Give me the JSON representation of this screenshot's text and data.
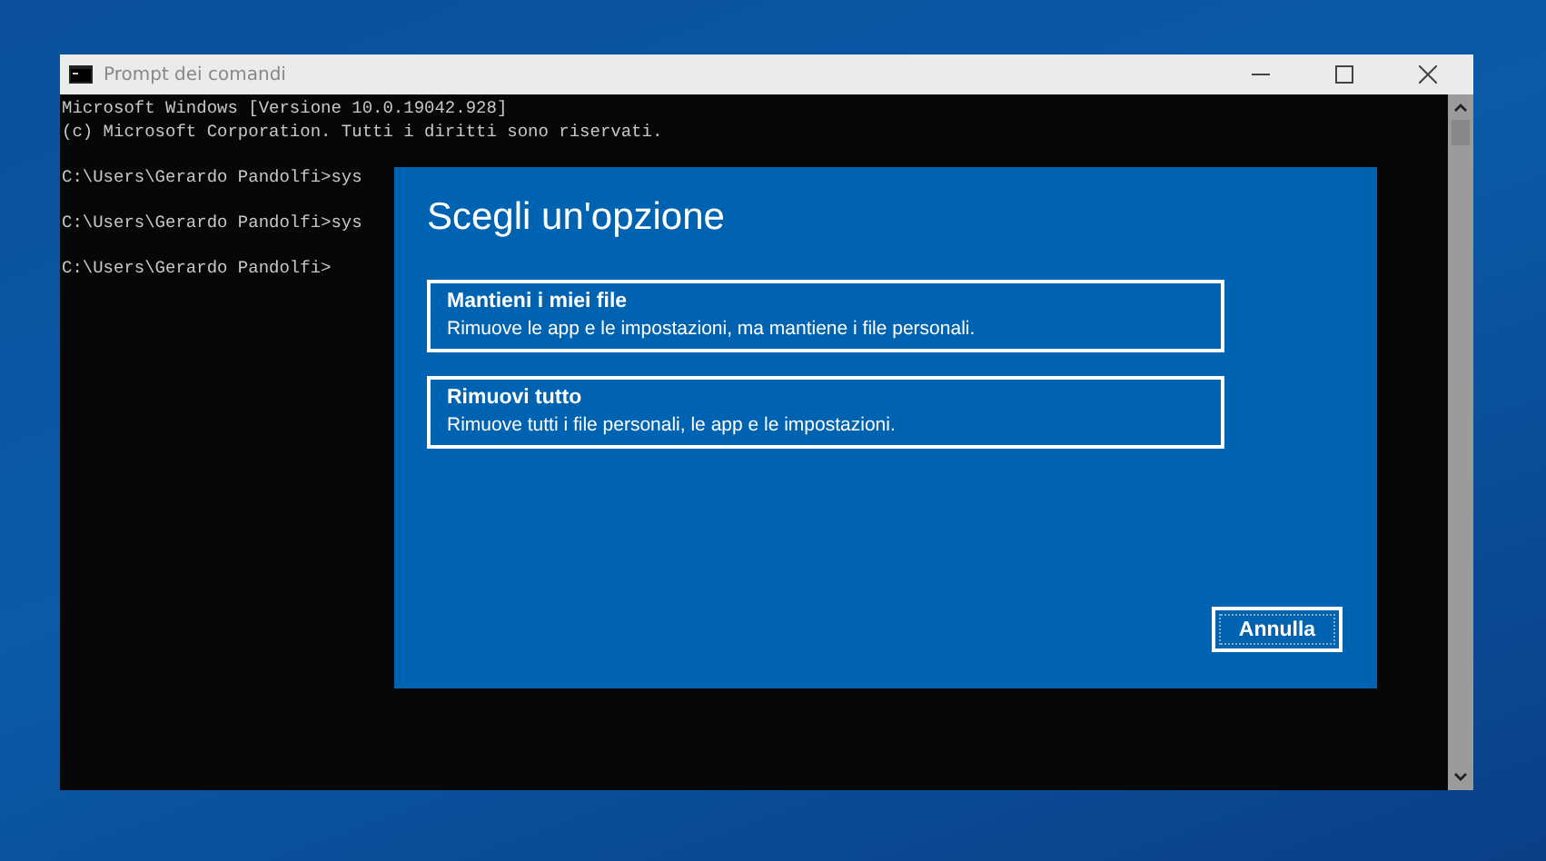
{
  "window": {
    "title": "Prompt dei comandi"
  },
  "console": {
    "blocks": [
      [
        "Microsoft Windows [Versione 10.0.19042.928]",
        "(c) Microsoft Corporation. Tutti i diritti sono riservati."
      ],
      [
        "C:\\Users\\Gerardo Pandolfi>sys"
      ],
      [
        "C:\\Users\\Gerardo Pandolfi>sys"
      ],
      [
        "C:\\Users\\Gerardo Pandolfi>"
      ]
    ]
  },
  "dialog": {
    "title": "Scegli un'opzione",
    "options": [
      {
        "label": "Mantieni i miei file",
        "description": "Rimuove le app e le impostazioni, ma mantiene i file personali."
      },
      {
        "label": "Rimuovi tutto",
        "description": "Rimuove tutti i file personali, le app e le impostazioni."
      }
    ],
    "buttons": [
      "Annulla"
    ]
  }
}
